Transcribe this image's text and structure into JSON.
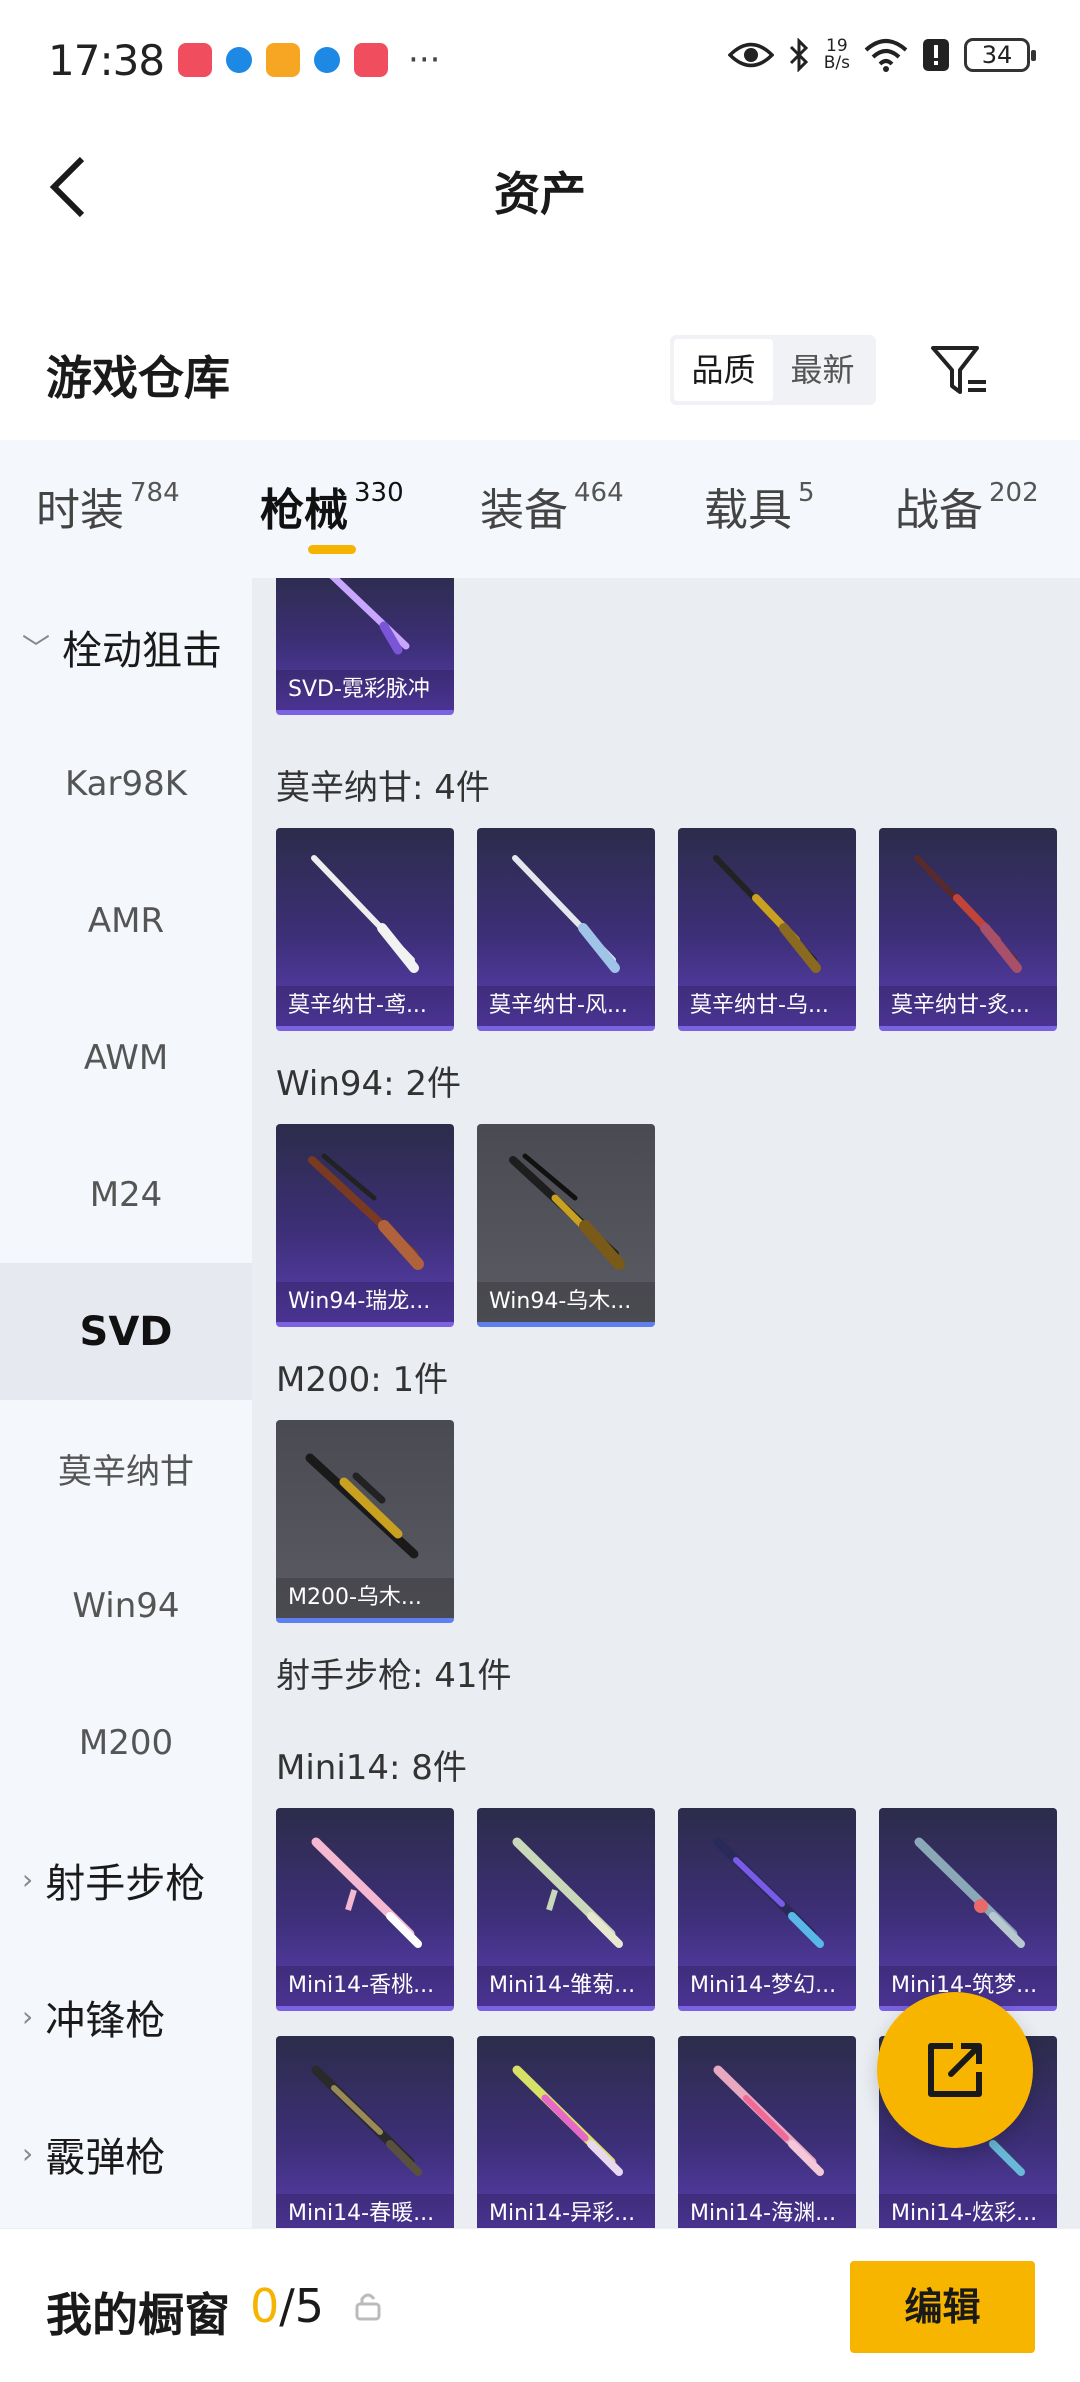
{
  "status_bar": {
    "time": "17:38",
    "overflow": "···",
    "net_speed_value": "19",
    "net_speed_unit": "B/s",
    "battery": "34",
    "app_icon_colors": [
      "#f04e5e",
      "#1e88e5",
      "#f6a623",
      "#1e88e5",
      "#f04e5e"
    ]
  },
  "header": {
    "title": "资产",
    "back_icon": "chevron-left-icon"
  },
  "section": {
    "title": "游戏仓库",
    "sort_options": [
      "品质",
      "最新"
    ],
    "sort_selected": "品质",
    "filter_icon": "filter-icon"
  },
  "tabs": [
    {
      "label": "时装",
      "count": "784"
    },
    {
      "label": "枪械",
      "count": "330",
      "active": true
    },
    {
      "label": "装备",
      "count": "464"
    },
    {
      "label": "载具",
      "count": "5"
    },
    {
      "label": "战备",
      "count": "202"
    }
  ],
  "sidebar": {
    "items": [
      {
        "label": "栓动狙击",
        "type": "group",
        "expanded": true
      },
      {
        "label": "Kar98K"
      },
      {
        "label": "AMR"
      },
      {
        "label": "AWM"
      },
      {
        "label": "M24"
      },
      {
        "label": "SVD",
        "selected": true
      },
      {
        "label": "莫辛纳甘"
      },
      {
        "label": "Win94"
      },
      {
        "label": "M200"
      },
      {
        "label": "射手步枪",
        "type": "group"
      },
      {
        "label": "冲锋枪",
        "type": "group"
      },
      {
        "label": "霰弹枪",
        "type": "group"
      }
    ]
  },
  "content": {
    "svd_item": "SVD-霓彩脉冲",
    "groups": {
      "mosin": {
        "title": "莫辛纳甘: 4件",
        "items": [
          "莫辛纳甘-鸢...",
          "莫辛纳甘-风...",
          "莫辛纳甘-乌...",
          "莫辛纳甘-炙..."
        ]
      },
      "win94": {
        "title": "Win94: 2件",
        "items": [
          "Win94-瑞龙...",
          "Win94-乌木..."
        ]
      },
      "m200": {
        "title": "M200: 1件",
        "items": [
          "M200-乌木..."
        ]
      },
      "dmr": {
        "title": "射手步枪: 41件"
      },
      "mini14": {
        "title": "Mini14: 8件",
        "items": [
          "Mini14-香桃...",
          "Mini14-雏菊...",
          "Mini14-梦幻...",
          "Mini14-筑梦...",
          "Mini14-春暖...",
          "Mini14-异彩...",
          "Mini14-海渊...",
          "Mini14-炫彩..."
        ]
      }
    }
  },
  "fab": {
    "icon": "share-export-icon"
  },
  "bottom_bar": {
    "title": "我的橱窗",
    "count_current": "0",
    "count_total": "/5",
    "lock_icon": "lock-icon",
    "edit_label": "编辑"
  },
  "colors": {
    "accent": "#f8b500",
    "card_purple": "#3d2f78",
    "card_gray": "#55555d"
  }
}
